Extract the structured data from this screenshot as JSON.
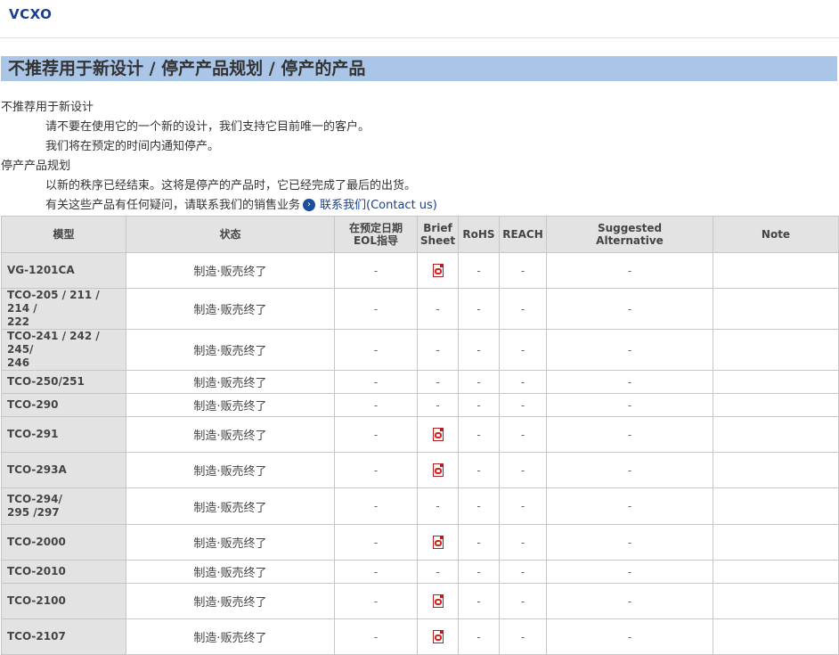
{
  "header": {
    "brand": "VCXO"
  },
  "section": {
    "title": "不推荐用于新设计 / 停产产品规划 / 停产的产品"
  },
  "info": {
    "not_recommended_heading": "不推荐用于新设计",
    "not_recommended_line1": "请不要在使用它的一个新的设计，我们支持它目前唯一的客户。",
    "not_recommended_line2": "我们将在预定的时间内通知停产。",
    "discontinued_heading": "停产产品规划",
    "discontinued_line1": "以新的秩序已经结束。这将是停产的产品时，它已经完成了最后的出货。",
    "inquiry_text": "有关这些产品有任何疑问，请联系我们的销售业务",
    "contact_link": "联系我们(Contact us)"
  },
  "table": {
    "headers": {
      "model": "模型",
      "status": "状态",
      "eol_line1": "在预定日期",
      "eol_line2": "EOL指导",
      "brief_line1": "Brief",
      "brief_line2": "Sheet",
      "rohs": "RoHS",
      "reach": "REACH",
      "suggested_line1": "Suggested",
      "suggested_line2": "Alternative",
      "note": "Note"
    },
    "rows": [
      {
        "model_l1": "VG-1201CA",
        "model_l2": "",
        "status": "制造·贩売终了",
        "eol": "-",
        "brief_pdf": true,
        "rohs": "-",
        "reach": "-",
        "alt": "-",
        "note": ""
      },
      {
        "model_l1": "TCO-205 / 211 / 214 /",
        "model_l2": "222",
        "status": "制造·贩売终了",
        "eol": "-",
        "brief_pdf": false,
        "brief": "-",
        "rohs": "-",
        "reach": "-",
        "alt": "-",
        "note": ""
      },
      {
        "model_l1": "TCO-241 / 242 / 245/",
        "model_l2": "246",
        "status": "制造·贩売终了",
        "eol": "-",
        "brief_pdf": false,
        "brief": "-",
        "rohs": "-",
        "reach": "-",
        "alt": "-",
        "note": ""
      },
      {
        "model_l1": "TCO-250/251",
        "model_l2": "",
        "status": "制造·贩売终了",
        "eol": "-",
        "brief_pdf": false,
        "brief": "-",
        "rohs": "-",
        "reach": "-",
        "alt": "-",
        "note": ""
      },
      {
        "model_l1": "TCO-290",
        "model_l2": "",
        "status": "制造·贩売终了",
        "eol": "-",
        "brief_pdf": false,
        "brief": "-",
        "rohs": "-",
        "reach": "-",
        "alt": "-",
        "note": ""
      },
      {
        "model_l1": "TCO-291",
        "model_l2": "",
        "status": "制造·贩売终了",
        "eol": "-",
        "brief_pdf": true,
        "rohs": "-",
        "reach": "-",
        "alt": "-",
        "note": ""
      },
      {
        "model_l1": "TCO-293A",
        "model_l2": "",
        "status": "制造·贩売终了",
        "eol": "-",
        "brief_pdf": true,
        "rohs": "-",
        "reach": "-",
        "alt": "-",
        "note": ""
      },
      {
        "model_l1": "TCO-294/",
        "model_l2": "295 /297",
        "status": "制造·贩売终了",
        "eol": "-",
        "brief_pdf": false,
        "brief": "-",
        "rohs": "-",
        "reach": "-",
        "alt": "-",
        "note": ""
      },
      {
        "model_l1": "TCO-2000",
        "model_l2": "",
        "status": "制造·贩売终了",
        "eol": "-",
        "brief_pdf": true,
        "rohs": "-",
        "reach": "-",
        "alt": "-",
        "note": ""
      },
      {
        "model_l1": "TCO-2010",
        "model_l2": "",
        "status": "制造·贩売终了",
        "eol": "-",
        "brief_pdf": false,
        "brief": "-",
        "rohs": "-",
        "reach": "-",
        "alt": "-",
        "note": ""
      },
      {
        "model_l1": "TCO-2100",
        "model_l2": "",
        "status": "制造·贩売终了",
        "eol": "-",
        "brief_pdf": true,
        "rohs": "-",
        "reach": "-",
        "alt": "-",
        "note": ""
      },
      {
        "model_l1": "TCO-2107",
        "model_l2": "",
        "status": "制造·贩売终了",
        "eol": "-",
        "brief_pdf": true,
        "rohs": "-",
        "reach": "-",
        "alt": "-",
        "note": ""
      }
    ]
  }
}
